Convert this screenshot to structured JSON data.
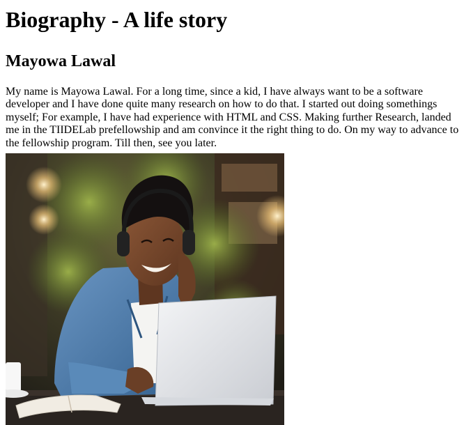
{
  "page": {
    "title": "Biography - A life story",
    "name_heading": "Mayowa Lawal",
    "bio_text": "My name is Mayowa Lawal. For a long time, since a kid, I have always want to be a software developer and I have done quite many research on how to do that. I started out doing somethings myself; For example, I have had experience with HTML and CSS. Making further Research, landed me in the TIIDELab prefellowship and am convince it the right thing to do. On my way to advance to the fellowship program. Till then, see you later."
  },
  "photo": {
    "icon": "person-with-laptop-photo",
    "colors": {
      "background_dark": "#2b2a1f",
      "foliage": "#5f7a2c",
      "light_glow": "#f2c77a",
      "skin": "#7a4a2e",
      "hair": "#141010",
      "shirt_denim": "#4f7fb0",
      "tshirt": "#f4f4f2",
      "laptop": "#e6e8ec",
      "table": "#2a2420",
      "book": "#f1ece3",
      "cup": "#f7f7f7"
    }
  }
}
